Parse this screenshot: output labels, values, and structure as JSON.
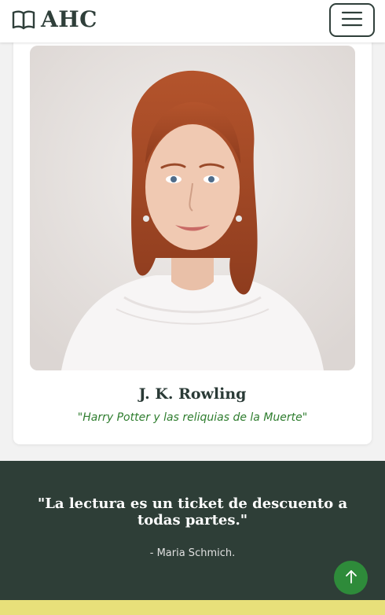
{
  "header": {
    "brand_text": "AHC",
    "menu_icon": "hamburger-menu-icon",
    "brand_icon": "open-book-icon"
  },
  "card": {
    "author_name": "J. K. Rowling",
    "book_title": "\"Harry Potter y las reliquias de la Muerte\""
  },
  "quote": {
    "text": "\"La lectura es un ticket de descuento a todas partes.\"",
    "author": "- Maria Schmich."
  },
  "scroll_top": {
    "icon": "arrow-up-icon"
  },
  "colors": {
    "header_bg": "#ffffff",
    "brand": "#2f3f3a",
    "quote_bg": "#2e3e37",
    "accent_green": "#2e8b3a",
    "book_title": "#2e7d2e",
    "footer_strip": "#e8e07a"
  }
}
